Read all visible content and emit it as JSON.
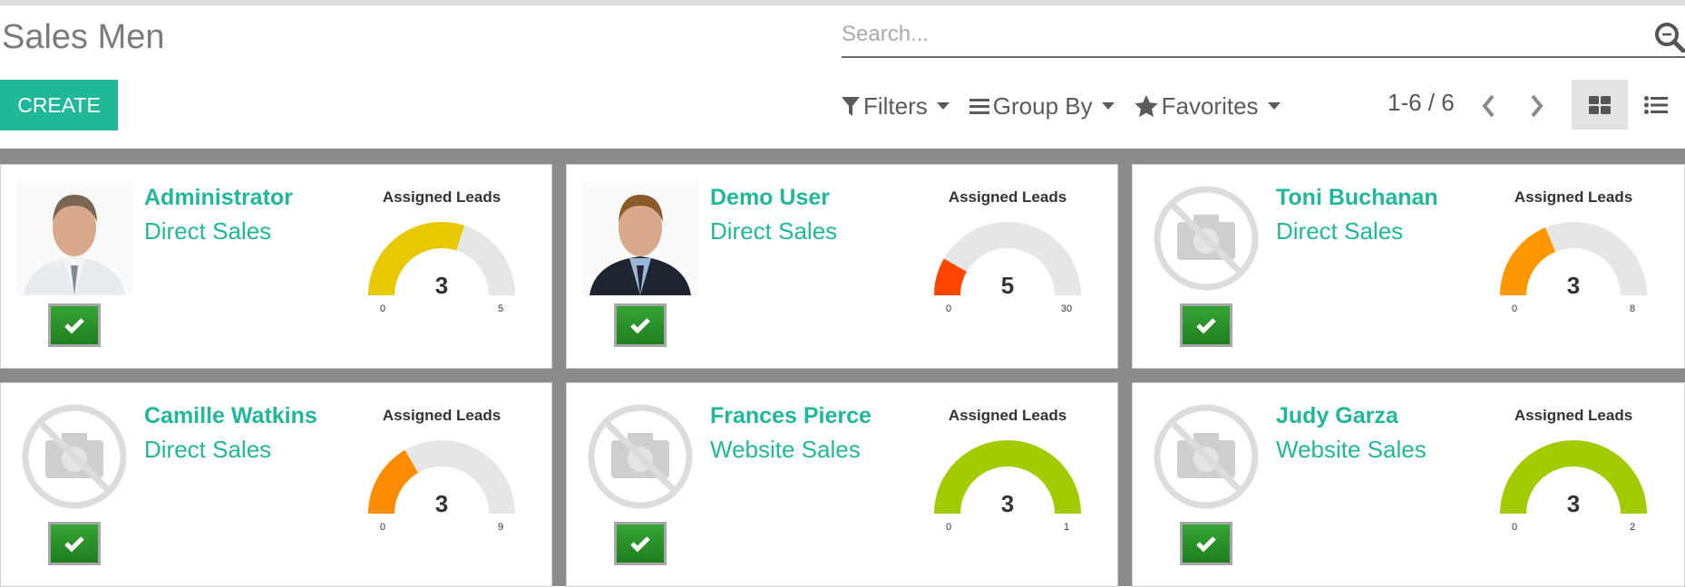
{
  "page": {
    "title": "Sales Men",
    "create_label": "CREATE",
    "search_placeholder": "Search...",
    "filters": [
      {
        "label": "Filters",
        "icon": "filter-icon"
      },
      {
        "label": "Group By",
        "icon": "bars-icon"
      },
      {
        "label": "Favorites",
        "icon": "star-icon"
      }
    ],
    "pager": "1-6 / 6",
    "views": [
      {
        "name": "kanban",
        "icon": "grid-icon",
        "active": true
      },
      {
        "name": "list",
        "icon": "list-icon",
        "active": false
      }
    ]
  },
  "cards": [
    {
      "name": "Administrator",
      "team": "Direct Sales",
      "avatar": "photo-man-older",
      "gauge_title": "Assigned Leads",
      "value": 3,
      "min": 0,
      "max": 5,
      "color": "#e8c800"
    },
    {
      "name": "Demo User",
      "team": "Direct Sales",
      "avatar": "photo-man-young",
      "gauge_title": "Assigned Leads",
      "value": 5,
      "min": 0,
      "max": 30,
      "color": "#ff4500"
    },
    {
      "name": "Toni Buchanan",
      "team": "Direct Sales",
      "avatar": "no-photo",
      "gauge_title": "Assigned Leads",
      "value": 3,
      "min": 0,
      "max": 8,
      "color": "#ff9800"
    },
    {
      "name": "Camille Watkins",
      "team": "Direct Sales",
      "avatar": "no-photo",
      "gauge_title": "Assigned Leads",
      "value": 3,
      "min": 0,
      "max": 9,
      "color": "#ff8c00"
    },
    {
      "name": "Frances Pierce",
      "team": "Website Sales",
      "avatar": "no-photo",
      "gauge_title": "Assigned Leads",
      "value": 3,
      "min": 0,
      "max": 1,
      "color": "#a2cc00"
    },
    {
      "name": "Judy Garza",
      "team": "Website Sales",
      "avatar": "no-photo",
      "gauge_title": "Assigned Leads",
      "value": 3,
      "min": 0,
      "max": 2,
      "color": "#a2cc00"
    }
  ]
}
